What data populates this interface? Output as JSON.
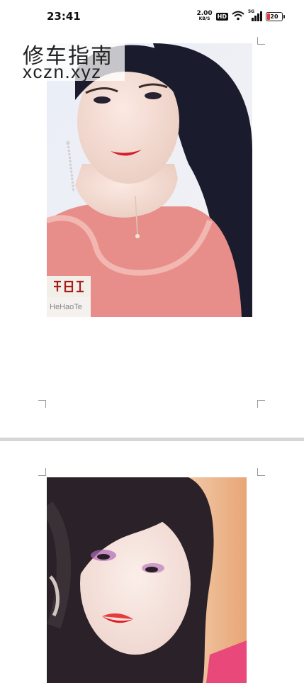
{
  "status_bar": {
    "time": "23:41",
    "net_speed_value": "2.00",
    "net_speed_unit": "KB/S",
    "hd_badge": "HD",
    "network_label": "5G",
    "battery_level": "20",
    "battery_fraction": 0.2
  },
  "watermark": {
    "title": "修车指南",
    "url": "xczn.xyz"
  },
  "document": {
    "page1_image_caption": "HeHaoTe",
    "pages": 2
  },
  "colors": {
    "battery_low": "#e5382f",
    "stamp_red": "#a81c1c",
    "page_separator": "#d6d6d6"
  },
  "icons": [
    "wifi-icon",
    "signal-icon",
    "battery-icon"
  ]
}
